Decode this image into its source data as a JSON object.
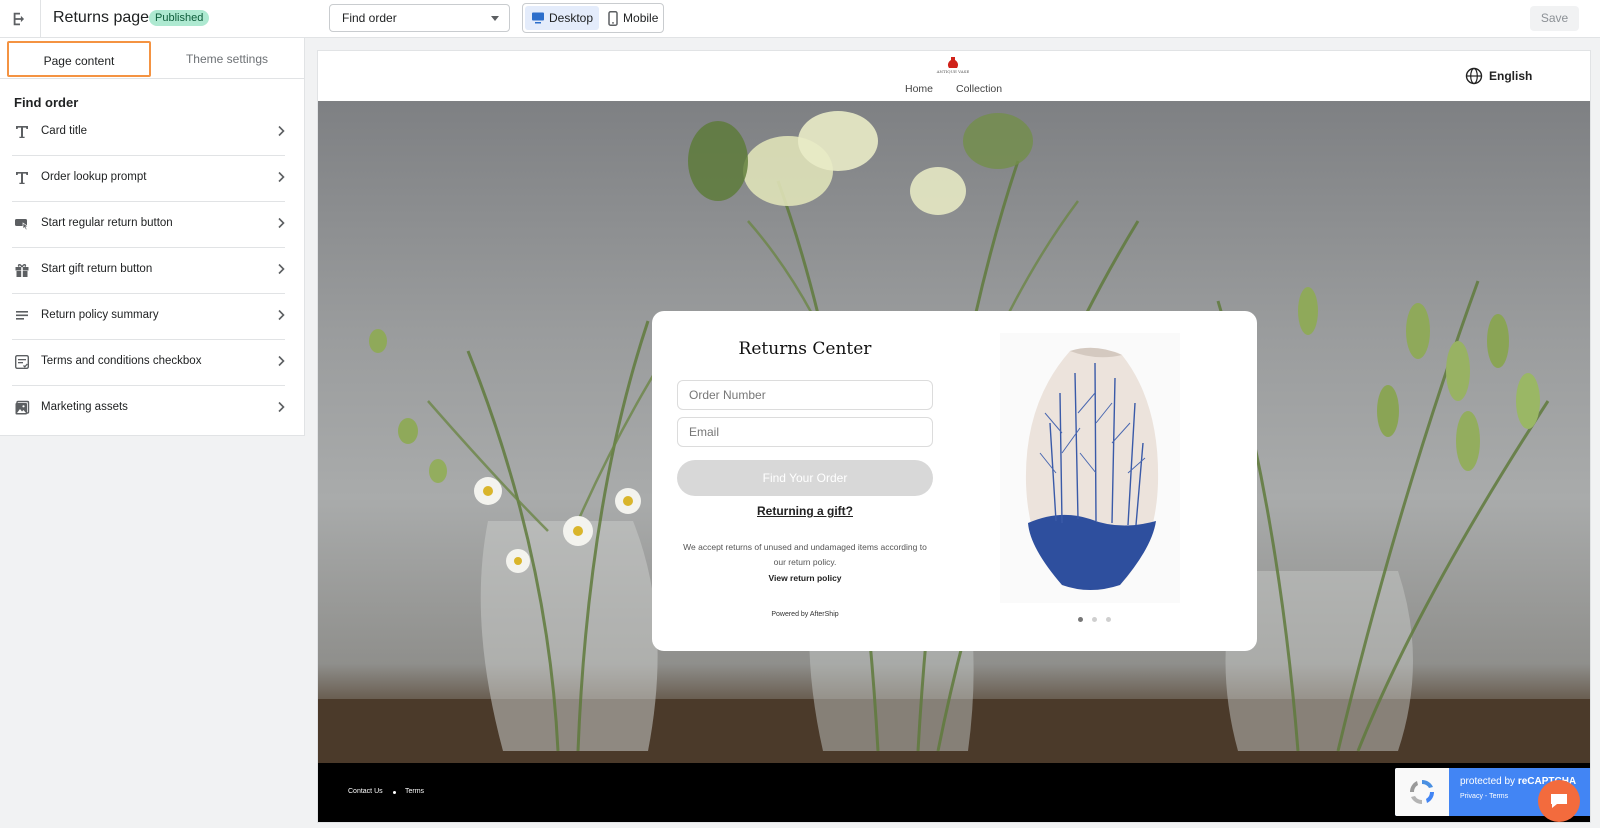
{
  "topbar": {
    "title": "Returns page",
    "status_badge": "Published",
    "page_select_value": "Find order",
    "device_desktop": "Desktop",
    "device_mobile": "Mobile",
    "save_label": "Save"
  },
  "panel": {
    "tabs": [
      "Page content",
      "Theme settings"
    ],
    "section_heading": "Find order",
    "items": [
      {
        "label": "Card title",
        "icon": "text-icon"
      },
      {
        "label": "Order lookup prompt",
        "icon": "text-icon"
      },
      {
        "label": "Start regular return button",
        "icon": "button-icon"
      },
      {
        "label": "Start gift return button",
        "icon": "gift-icon"
      },
      {
        "label": "Return policy summary",
        "icon": "paragraph-icon"
      },
      {
        "label": "Terms and conditions checkbox",
        "icon": "checklist-icon"
      },
      {
        "label": "Marketing assets",
        "icon": "image-icon"
      }
    ]
  },
  "store": {
    "logo_text": "ANTIQUE VASE",
    "nav": [
      "Home",
      "Collection"
    ],
    "language": "English"
  },
  "card": {
    "title": "Returns Center",
    "order_placeholder": "Order Number",
    "email_placeholder": "Email",
    "find_button": "Find Your Order",
    "gift_link": "Returning a gift?",
    "policy_text": "We accept returns of unused and undamaged items according to our return policy.",
    "policy_link": "View return policy",
    "powered_by": "Powered by AfterShip",
    "carousel_dots": 3,
    "carousel_active": 1
  },
  "footer": {
    "links": [
      "Contact Us",
      "Terms"
    ]
  },
  "recaptcha": {
    "text_prefix": "protected by ",
    "text_brand": "reCAPTCHA",
    "privacy": "Privacy",
    "terms": "Terms"
  },
  "colors": {
    "accent_focus": "#f49342",
    "badge_bg": "#aee9d1",
    "recaptcha_blue": "#4285f4",
    "chat_orange": "#f36b3d",
    "footer_bg": "#000000"
  }
}
